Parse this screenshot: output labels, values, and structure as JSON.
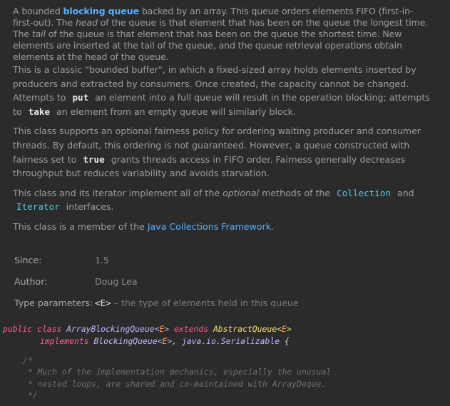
{
  "doc": {
    "p1": {
      "s1": "A bounded ",
      "link1": "blocking queue",
      "s2": " backed by an array. This queue orders elements FIFO (first-in-first-out). The ",
      "head": "head",
      "s3": " of the queue is that element that has been on the queue the longest time. The ",
      "tail": "tail",
      "s4": " of the queue is that element that has been on the queue the shortest time. New elements are inserted at the tail of the queue, and the queue retrieval operations obtain elements at the head of the queue."
    },
    "p2": {
      "s1": "This is a classic \"bounded buffer\", in which a fixed-sized array holds elements inserted by producers and extracted by consumers. Once created, the capacity cannot be changed. Attempts to ",
      "put": "put",
      "s2": " an element into a full queue will result in the operation blocking; attempts to ",
      "take": "take",
      "s3": " an element from an empty queue will similarly block."
    },
    "p3": {
      "s1": "This class supports an optional fairness policy for ordering waiting producer and consumer threads. By default, this ordering is not guaranteed. However, a queue constructed with fairness set to ",
      "true": "true",
      "s2": " grants threads access in FIFO order. Fairness generally decreases throughput but reduces variability and avoids starvation."
    },
    "p4": {
      "s1": "This class and its iterator implement all of the ",
      "optional": "optional",
      "s2": " methods of the ",
      "collection": "Collection",
      "s3": " and ",
      "iterator": "Iterator",
      "s4": " interfaces."
    },
    "p5": {
      "s1": "This class is a member of the ",
      "link": "Java Collections Framework",
      "s2": "."
    },
    "since_label": "Since:",
    "since_value": "1.5",
    "author_label": "Author:",
    "author_value": "Doug Lea",
    "type_params_label": "Type parameters:",
    "type_param": "<E>",
    "type_param_desc": " – the type of elements held in this queue"
  },
  "code": {
    "public": "public",
    "class": "class",
    "classname": "ArrayBlockingQueue",
    "lt": "<",
    "E": "E",
    "gt": ">",
    "extends": "extends",
    "abstractqueue": "AbstractQueue",
    "implements": "implements",
    "blockingqueue": "BlockingQueue",
    "serializable": "java.io.Serializable",
    "comma": ",",
    "brace": "{",
    "c1": "/*",
    "c2": " * Much of the implementation mechanics, especially the unusual",
    "c3": " * nested loops, are shared and co-maintained with ArrayDeque.",
    "c4": " */"
  }
}
